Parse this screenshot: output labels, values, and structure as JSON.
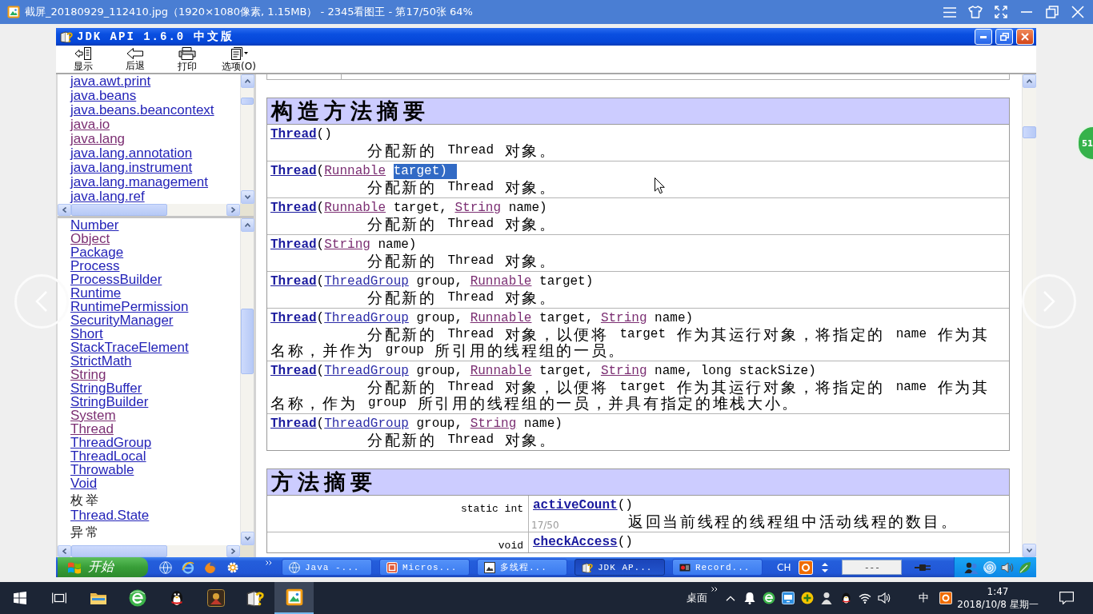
{
  "viewer": {
    "title": "截屏_20180929_112410.jpg（1920×1080像素, 1.15MB） - 2345看图王 - 第17/50张 64%",
    "page_counter": "17/50",
    "floating_badge": "51"
  },
  "window": {
    "title": "JDK API 1.6.0 中文版"
  },
  "toolbar": [
    {
      "kind": "show",
      "label": "显示"
    },
    {
      "kind": "back",
      "label": "后退"
    },
    {
      "kind": "print",
      "label": "打印"
    },
    {
      "kind": "options",
      "label": "选项(O)"
    }
  ],
  "packages": [
    {
      "label": "java.awt.print",
      "visited": false
    },
    {
      "label": "java.beans",
      "visited": false
    },
    {
      "label": "java.beans.beancontext",
      "visited": false
    },
    {
      "label": "java.io",
      "visited": true
    },
    {
      "label": "java.lang",
      "visited": true
    },
    {
      "label": "java.lang.annotation",
      "visited": false
    },
    {
      "label": "java.lang.instrument",
      "visited": false
    },
    {
      "label": "java.lang.management",
      "visited": false
    },
    {
      "label": "java.lang.ref",
      "visited": false
    }
  ],
  "class_groups": [
    {
      "items": [
        {
          "label": "Number",
          "visited": false
        },
        {
          "label": "Object",
          "visited": true
        },
        {
          "label": "Package",
          "visited": false
        },
        {
          "label": "Process",
          "visited": false
        },
        {
          "label": "ProcessBuilder",
          "visited": false
        },
        {
          "label": "Runtime",
          "visited": false
        },
        {
          "label": "RuntimePermission",
          "visited": false
        },
        {
          "label": "SecurityManager",
          "visited": false
        },
        {
          "label": "Short",
          "visited": false
        },
        {
          "label": "StackTraceElement",
          "visited": false
        },
        {
          "label": "StrictMath",
          "visited": false
        },
        {
          "label": "String",
          "visited": true
        },
        {
          "label": "StringBuffer",
          "visited": false
        },
        {
          "label": "StringBuilder",
          "visited": false
        },
        {
          "label": "System",
          "visited": true
        },
        {
          "label": "Thread",
          "visited": true
        },
        {
          "label": "ThreadGroup",
          "visited": false
        },
        {
          "label": "ThreadLocal",
          "visited": false
        },
        {
          "label": "Throwable",
          "visited": false
        },
        {
          "label": "Void",
          "visited": false
        }
      ]
    },
    {
      "heading": "枚举",
      "items": [
        {
          "label": "Thread.State",
          "visited": false
        }
      ]
    },
    {
      "heading": "异常"
    }
  ],
  "constructor_summary": {
    "title": "构造方法摘要",
    "rows": [
      {
        "signature": [
          {
            "kind": "method",
            "text": "Thread"
          },
          {
            "kind": "text",
            "text": "()"
          }
        ],
        "description": "分配新的 Thread 对象。"
      },
      {
        "signature": [
          {
            "kind": "method",
            "text": "Thread"
          },
          {
            "kind": "text",
            "text": "("
          },
          {
            "kind": "visited-type",
            "text": "Runnable"
          },
          {
            "kind": "selection",
            "text": "target)"
          }
        ],
        "description": "分配新的 Thread 对象。"
      },
      {
        "signature": [
          {
            "kind": "method",
            "text": "Thread"
          },
          {
            "kind": "text",
            "text": "("
          },
          {
            "kind": "visited-type",
            "text": "Runnable"
          },
          {
            "kind": "text",
            "text": " target, "
          },
          {
            "kind": "visited-type",
            "text": "String"
          },
          {
            "kind": "text",
            "text": " name)"
          }
        ],
        "description": "分配新的 Thread 对象。"
      },
      {
        "signature": [
          {
            "kind": "method",
            "text": "Thread"
          },
          {
            "kind": "text",
            "text": "("
          },
          {
            "kind": "visited-type",
            "text": "String"
          },
          {
            "kind": "text",
            "text": " name)"
          }
        ],
        "description": "分配新的 Thread 对象。"
      },
      {
        "signature": [
          {
            "kind": "method",
            "text": "Thread"
          },
          {
            "kind": "text",
            "text": "("
          },
          {
            "kind": "type",
            "text": "ThreadGroup"
          },
          {
            "kind": "text",
            "text": " group, "
          },
          {
            "kind": "visited-type",
            "text": "Runnable"
          },
          {
            "kind": "text",
            "text": " target)"
          }
        ],
        "description": "分配新的 Thread 对象。"
      },
      {
        "signature": [
          {
            "kind": "method",
            "text": "Thread"
          },
          {
            "kind": "text",
            "text": "("
          },
          {
            "kind": "type",
            "text": "ThreadGroup"
          },
          {
            "kind": "text",
            "text": " group, "
          },
          {
            "kind": "visited-type",
            "text": "Runnable"
          },
          {
            "kind": "text",
            "text": " target, "
          },
          {
            "kind": "visited-type",
            "text": "String"
          },
          {
            "kind": "text",
            "text": " name)"
          }
        ],
        "description": "分配新的 Thread 对象，以便将 target 作为其运行对象，将指定的 name 作为其名称，并作为 group 所引用的线程组的一员。"
      },
      {
        "signature": [
          {
            "kind": "method",
            "text": "Thread"
          },
          {
            "kind": "text",
            "text": "("
          },
          {
            "kind": "type",
            "text": "ThreadGroup"
          },
          {
            "kind": "text",
            "text": " group, "
          },
          {
            "kind": "visited-type",
            "text": "Runnable"
          },
          {
            "kind": "text",
            "text": " target, "
          },
          {
            "kind": "visited-type",
            "text": "String"
          },
          {
            "kind": "text",
            "text": " name, long stackSize)"
          }
        ],
        "description": "分配新的 Thread 对象，以便将 target 作为其运行对象，将指定的 name 作为其名称，作为 group 所引用的线程组的一员，并具有指定的堆栈大小。"
      },
      {
        "signature": [
          {
            "kind": "method",
            "text": "Thread"
          },
          {
            "kind": "text",
            "text": "("
          },
          {
            "kind": "type",
            "text": "ThreadGroup"
          },
          {
            "kind": "text",
            "text": " group, "
          },
          {
            "kind": "visited-type",
            "text": "String"
          },
          {
            "kind": "text",
            "text": " name)"
          }
        ],
        "description": "分配新的 Thread 对象。"
      }
    ]
  },
  "method_summary": {
    "title": "方法摘要",
    "rows": [
      {
        "modifier": "static int",
        "signature": [
          {
            "kind": "method",
            "text": "activeCount"
          },
          {
            "kind": "text",
            "text": "()"
          }
        ],
        "description": "返回当前线程的线程组中活动线程的数目。"
      },
      {
        "modifier": "void",
        "signature": [
          {
            "kind": "method",
            "text": "checkAccess"
          },
          {
            "kind": "text",
            "text": "()"
          }
        ]
      }
    ]
  },
  "xp_taskbar": {
    "start": "开始",
    "tasks": [
      {
        "kind": "globe",
        "label": "Java -...",
        "active": false
      },
      {
        "kind": "window",
        "label": "Micros...",
        "active": false
      },
      {
        "kind": "picture",
        "label": "多线程...",
        "active": false
      },
      {
        "kind": "help",
        "label": "JDK AP...",
        "active": true
      },
      {
        "kind": "record",
        "label": "Record...",
        "active": false
      }
    ],
    "language": "CH",
    "status_field": "---"
  },
  "taskbar": {
    "apps": [
      {
        "kind": "task-view",
        "active": false
      },
      {
        "kind": "folder",
        "active": false
      },
      {
        "kind": "browser",
        "active": false
      },
      {
        "kind": "penguin",
        "active": false
      },
      {
        "kind": "portrait",
        "active": false
      },
      {
        "kind": "help",
        "active": false
      },
      {
        "kind": "viewer",
        "active": true
      }
    ],
    "desktop_label": "桌面",
    "ime": "中",
    "time": "1:47",
    "date": "2018/10/8 星期一"
  }
}
